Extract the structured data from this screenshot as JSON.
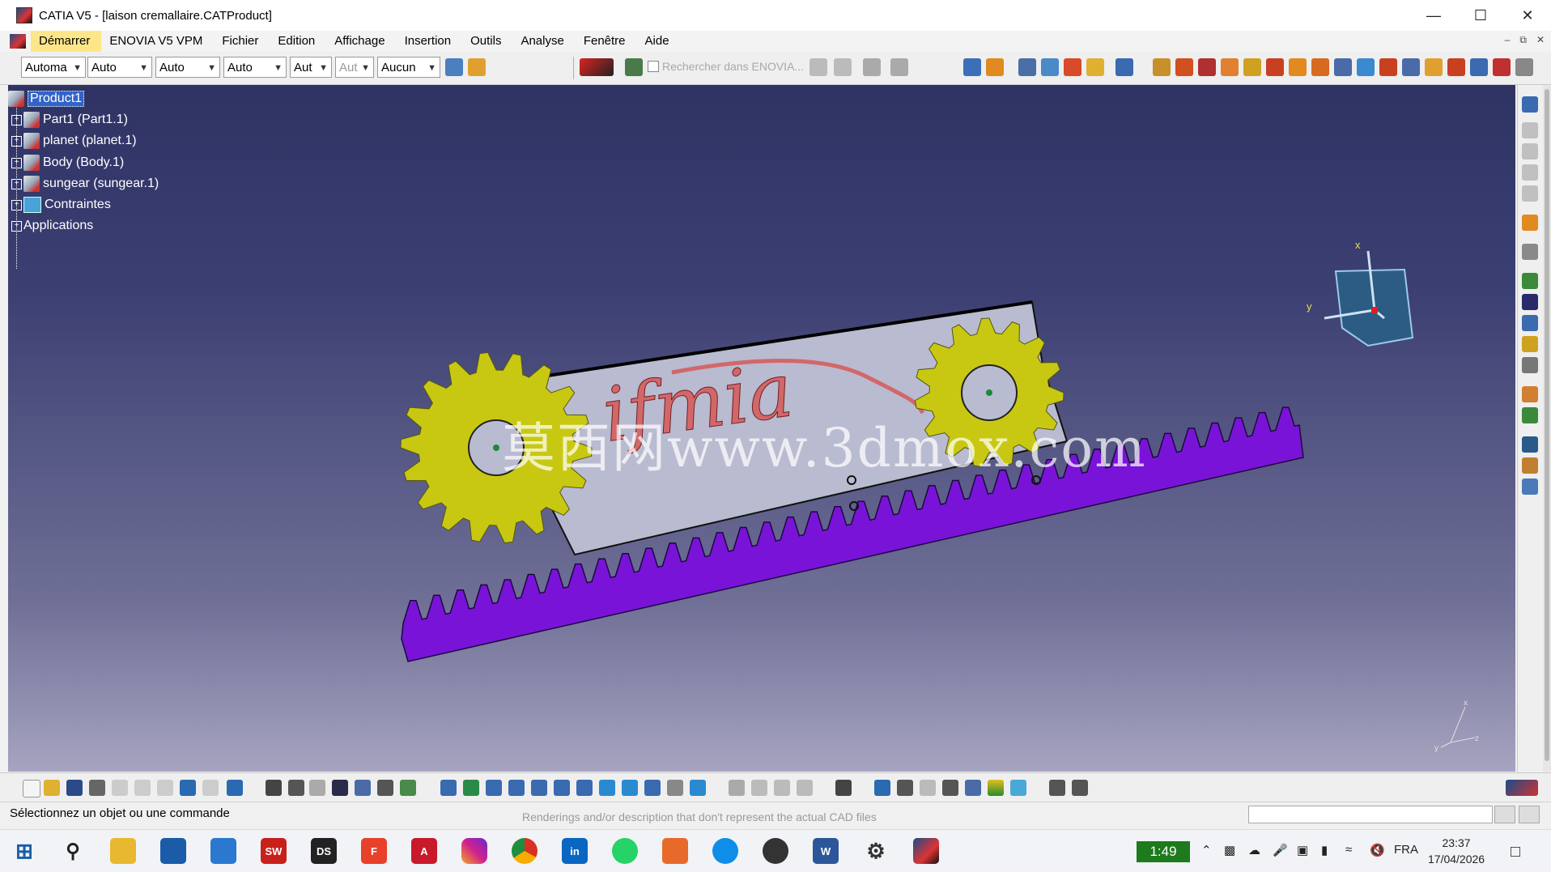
{
  "window": {
    "title": "CATIA V5 - [laison cremallaire.CATProduct]",
    "controls": [
      "minimize",
      "maximize",
      "close"
    ]
  },
  "menu": {
    "items": [
      "Démarrer",
      "ENOVIA V5 VPM",
      "Fichier",
      "Edition",
      "Affichage",
      "Insertion",
      "Outils",
      "Analyse",
      "Fenêtre",
      "Aide"
    ]
  },
  "toolbar": {
    "combos": [
      "Automa",
      "Auto",
      "Auto",
      "Auto",
      "Aut",
      "Aut",
      "Aucun"
    ],
    "enovia_search_placeholder": "Rechercher dans ENOVIA..."
  },
  "tree": {
    "root": "Product1",
    "children": [
      "Part1 (Part1.1)",
      "planet (planet.1)",
      "Body (Body.1)",
      "sungear (sungear.1)",
      "Contraintes"
    ],
    "applications": "Applications"
  },
  "viewport": {
    "watermark": "莫西网www.3dmox.com",
    "logo_text": "ifmia",
    "axis_x": "x",
    "axis_y": "y",
    "axis_z": "z",
    "colors": {
      "gear": "#c8c813",
      "rack": "#7a13d8",
      "plate": "#b9bbd0",
      "logo": "#d2676a"
    }
  },
  "status": {
    "message": "Sélectionnez un objet ou une commande",
    "ghost_text": "Renderings and/or description that don't represent the actual CAD files"
  },
  "taskbar": {
    "timer": "1:49",
    "lang": "FRA",
    "time": "23:37",
    "date": "17/04/2026",
    "apps": [
      "start",
      "search",
      "file-explorer",
      "store",
      "outlook",
      "solidworks",
      "catia-ds",
      "foxit",
      "autocad",
      "instagram",
      "chrome",
      "linkedin",
      "whatsapp",
      "paint-3d",
      "teamviewer",
      "obs",
      "word",
      "settings",
      "catia"
    ]
  }
}
